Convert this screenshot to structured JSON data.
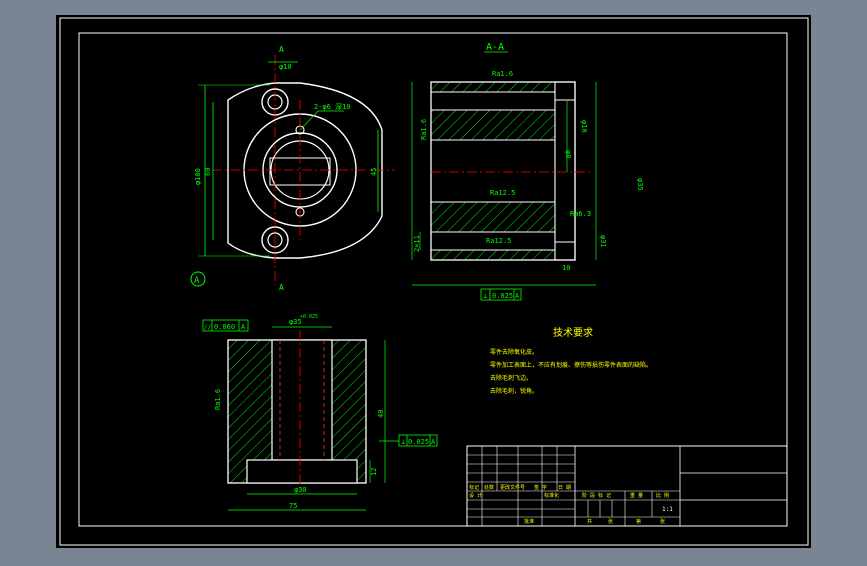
{
  "colors": {
    "background": "#7a8593",
    "sheet": "#000000",
    "line": "#ffffff",
    "dimension": "#00ff00",
    "centerline": "#ff0000",
    "accent": "#ffff00",
    "hidden": "#ff3030"
  },
  "section_title": "A-A",
  "top_view": {
    "section_mark_top": "A",
    "section_mark_bottom": "A",
    "datum_circle": "A",
    "dim_hole_spacing": "60",
    "dim_overall_height": "φ100",
    "dim_small_top": "φ10",
    "dim_side": "45",
    "dim_bolt_note": "2-φ6 深10"
  },
  "section_view": {
    "rough_top": "Ra1.6",
    "rough_left": "Ra1.6",
    "rough_mid": "Ra12.5",
    "rough_lower": "Ra12.5",
    "rough_right": "Ra6.3",
    "dim_right_upper": "φ10",
    "dim_right_mid": "φ8",
    "dim_right_lower": "φ31",
    "dim_left_bottom": "2×11",
    "dim_bottom_right": "10",
    "dim_far_right": "φ35",
    "tolerance_frame": [
      "⊥",
      "0.025",
      "A"
    ]
  },
  "bottom_view": {
    "tolerance_frame": [
      "//",
      "0.060",
      "A"
    ],
    "dim_bore": "φ35",
    "dim_bore_tol": "+0.025",
    "rough_left": "Ra1.6",
    "dim_height": "40",
    "dim_step": "12",
    "dim_inner_width": "φ30",
    "dim_outer_width": "75",
    "tolerance_frame_right": [
      "⊥",
      "0.025",
      "A"
    ]
  },
  "technical_requirements": {
    "title": "技术要求",
    "items": [
      "零件去除氧化皮。",
      "零件加工表面上，不应有划痕、擦伤等损伤零件表面的缺陷。",
      "去除毛刺飞边。",
      "去除毛刺，锐角。"
    ]
  },
  "title_block": {
    "labels_row1": [
      "标记",
      "处数",
      "更改文件号",
      "签 字",
      "日 期"
    ],
    "labels_row2": [
      "设 计",
      "",
      "标准化",
      "",
      ""
    ],
    "labels_stage": [
      "阶 段 标 记",
      "重 量",
      "比 例"
    ],
    "scale": "1:1",
    "labels_bottom": [
      "共",
      "张",
      "第",
      "张"
    ],
    "approve": "批准"
  }
}
